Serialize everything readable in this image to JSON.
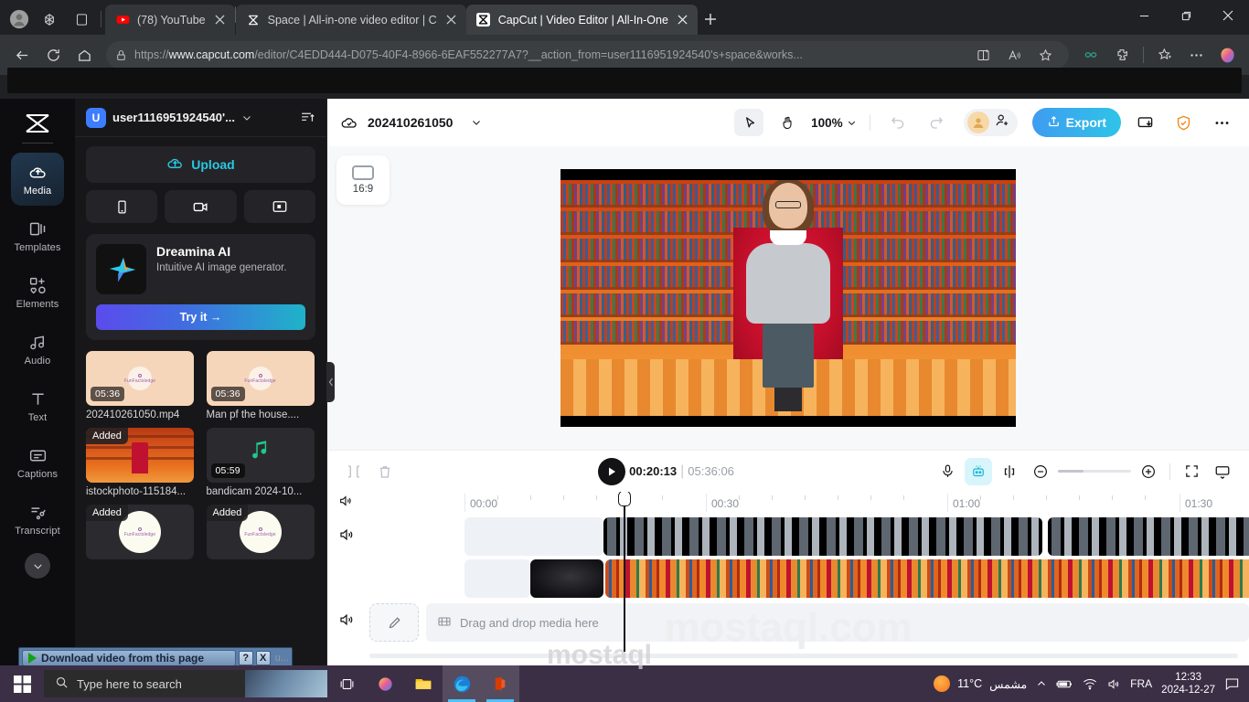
{
  "browser": {
    "tabs": [
      {
        "title": "(78) YouTube",
        "favicon": "youtube-icon",
        "active": false
      },
      {
        "title": "Space | All-in-one video editor | C",
        "favicon": "capcut-icon",
        "active": false
      },
      {
        "title": "CapCut | Video Editor | All-In-One",
        "favicon": "capcut-icon",
        "active": true
      }
    ],
    "new_tab_label": "+",
    "url_prefix": "https://",
    "url_bold": "www.capcut.com",
    "url_rest": "/editor/C4EDD444-D075-40F4-8966-6EAF552277A7?__action_from=user1116951924540's+space&works...",
    "window_controls": [
      "minimize",
      "restore",
      "close"
    ],
    "toolbar_icons": [
      "back-icon",
      "reload-icon",
      "home-icon",
      "lock-icon",
      "split-screen-icon",
      "read-aloud-icon",
      "favorite-icon",
      "copilot-icon",
      "extensions-icon",
      "collections-icon",
      "settings-more-icon",
      "profile-icon"
    ]
  },
  "rail": {
    "logo": "capcut-logo",
    "items": [
      {
        "label": "Media",
        "icon": "media-cloud-icon",
        "active": true
      },
      {
        "label": "Templates",
        "icon": "templates-icon",
        "active": false
      },
      {
        "label": "Elements",
        "icon": "elements-icon",
        "active": false
      },
      {
        "label": "Audio",
        "icon": "audio-icon",
        "active": false
      },
      {
        "label": "Text",
        "icon": "text-icon",
        "active": false
      },
      {
        "label": "Captions",
        "icon": "captions-icon",
        "active": false
      },
      {
        "label": "Transcript",
        "icon": "transcript-icon",
        "active": false
      }
    ],
    "more_icon": "chevron-down-icon"
  },
  "media_panel": {
    "account_initial": "U",
    "account_name": "user1116951924540'...",
    "sort_icon": "sort-icon",
    "upload_label": "Upload",
    "import_buttons": [
      "phone-import-icon",
      "record-video-icon",
      "screen-record-icon"
    ],
    "dreamina": {
      "title": "Dreamina AI",
      "subtitle": "Intuitive AI image generator.",
      "button_label": "Try it  →"
    },
    "items": [
      {
        "name": "202410261050.mp4",
        "duration": "05:36",
        "badge": "",
        "kind": "peach"
      },
      {
        "name": "Man pf the house....",
        "duration": "05:36",
        "badge": "",
        "kind": "peach"
      },
      {
        "name": "istockphoto-115184...",
        "duration": "",
        "badge": "Added",
        "kind": "library"
      },
      {
        "name": "bandicam 2024-10...",
        "duration": "05:59",
        "badge": "",
        "kind": "audio"
      },
      {
        "name": "u...",
        "duration": "",
        "badge": "Added",
        "kind": "funfacts"
      },
      {
        "name": "",
        "duration": "",
        "badge": "Added",
        "kind": "funfacts"
      }
    ],
    "funfacts_label": "FunFactsledge",
    "collapse_icon": "chevron-left-icon"
  },
  "download_popup": {
    "label": "Download video from this page",
    "help_label": "?",
    "close_label": "X",
    "play_icon": "play-triangle-icon"
  },
  "editor_top": {
    "cloud_icon": "cloud-saved-icon",
    "project_name": "202410261050",
    "project_caret": "chevron-down-icon",
    "select_tool_icon": "cursor-select-icon",
    "hand_tool_icon": "hand-pan-icon",
    "zoom_level": "100%",
    "undo_icon": "undo-icon",
    "redo_icon": "redo-icon",
    "collab_avatar": "user-avatar",
    "add_collaborator_icon": "add-person-icon",
    "export_label": "Export",
    "export_icon": "upload-share-icon",
    "download_app_icon": "download-app-icon",
    "shield_icon": "shield-check-icon",
    "more_icon": "more-horizontal-icon",
    "export_color": "#3f9cf0"
  },
  "preview": {
    "ratio_label": "16:9",
    "ratio_icon": "aspect-ratio-icon"
  },
  "playback": {
    "split_icon": "split-clip-icon",
    "delete_icon": "delete-icon",
    "play_icon": "play-icon",
    "current_time": "00:20:13",
    "separator": "|",
    "total_time": "05:36:06",
    "mic_icon": "microphone-icon",
    "auto_caption_icon": "ai-captions-icon",
    "keyframe_icon": "split-marker-icon",
    "zoom_out_icon": "zoom-out-icon",
    "zoom_in_icon": "zoom-in-icon",
    "fullscreen_icon": "fullscreen-icon",
    "player_icon": "player-window-icon"
  },
  "timeline": {
    "ruler_labels": [
      "00:00",
      "00:30",
      "01:00",
      "01:30"
    ],
    "tracks": [
      {
        "type": "video",
        "speaker_icon": "speaker-icon",
        "label": "person-clip-track"
      },
      {
        "type": "video",
        "speaker_icon": "",
        "label": "library-clip-track"
      },
      {
        "type": "placeholder",
        "speaker_icon": "speaker-icon",
        "label": "Drag and drop media here",
        "edit_icon": "edit-pen-icon",
        "media_icon": "media-film-icon"
      }
    ],
    "watermark": "mostaql.com",
    "playhead_time": "00:20:13"
  },
  "taskbar": {
    "start_icon": "windows-start-icon",
    "search_placeholder": "Type here to search",
    "search_icon": "search-icon",
    "apps": [
      "task-view-icon",
      "copilot-icon",
      "file-explorer-icon",
      "edge-icon",
      "office-icon"
    ],
    "watermark": "mostaql",
    "weather_temp": "11°C",
    "weather_desc": "مشمس",
    "tray_icons": [
      "show-hidden-icons-chevron",
      "battery-icon",
      "wifi-icon",
      "volume-icon"
    ],
    "language": "FRA",
    "time": "12:33",
    "date": "2024-12-27",
    "notifications_icon": "notifications-icon"
  }
}
